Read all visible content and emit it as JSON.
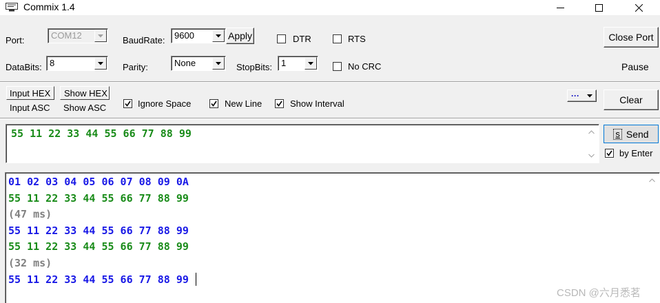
{
  "window": {
    "title": "Commix 1.4",
    "minimize": "—",
    "maximize": "☐",
    "close": "✕"
  },
  "row1": {
    "port_label": "Port:",
    "port_value": "COM12",
    "baud_label": "BaudRate:",
    "baud_value": "9600",
    "apply": "Apply",
    "dtr": "DTR",
    "rts": "RTS",
    "close_port": "Close Port"
  },
  "row2": {
    "databits_label": "DataBits:",
    "databits_value": "8",
    "parity_label": "Parity:",
    "parity_value": "None",
    "stopbits_label": "StopBits:",
    "stopbits_value": "1",
    "no_crc": "No CRC",
    "pause": "Pause"
  },
  "row3": {
    "input_hex": "Input HEX",
    "input_asc": "Input ASC",
    "show_hex": "Show HEX",
    "show_asc": "Show ASC",
    "ignore_space": "Ignore Space",
    "new_line": "New Line",
    "show_interval": "Show Interval",
    "more": "···",
    "clear": "Clear"
  },
  "send": {
    "input_value": "55 11 22 33 44 55 66 77 88 99",
    "send_button": "Send",
    "send_hotkey": "s",
    "by_enter": "by Enter"
  },
  "colors": {
    "sent": "#1919e6",
    "received": "#1a8c1a",
    "interval": "#808080"
  },
  "output": {
    "lines": [
      {
        "text": "01 02 03 04 05 06 07 08 09 0A",
        "kind": "sent"
      },
      {
        "text": "55 11 22 33 44 55 66 77 88 99",
        "kind": "received"
      },
      {
        "text": "(47 ms)",
        "kind": "interval"
      },
      {
        "text": "55 11 22 33 44 55 66 77 88 99",
        "kind": "sent"
      },
      {
        "text": "55 11 22 33 44 55 66 77 88 99",
        "kind": "received"
      },
      {
        "text": "(32 ms)",
        "kind": "interval"
      },
      {
        "text": "55 11 22 33 44 55 66 77 88 99",
        "kind": "sent"
      }
    ]
  },
  "watermark": "CSDN @六月悉茗"
}
